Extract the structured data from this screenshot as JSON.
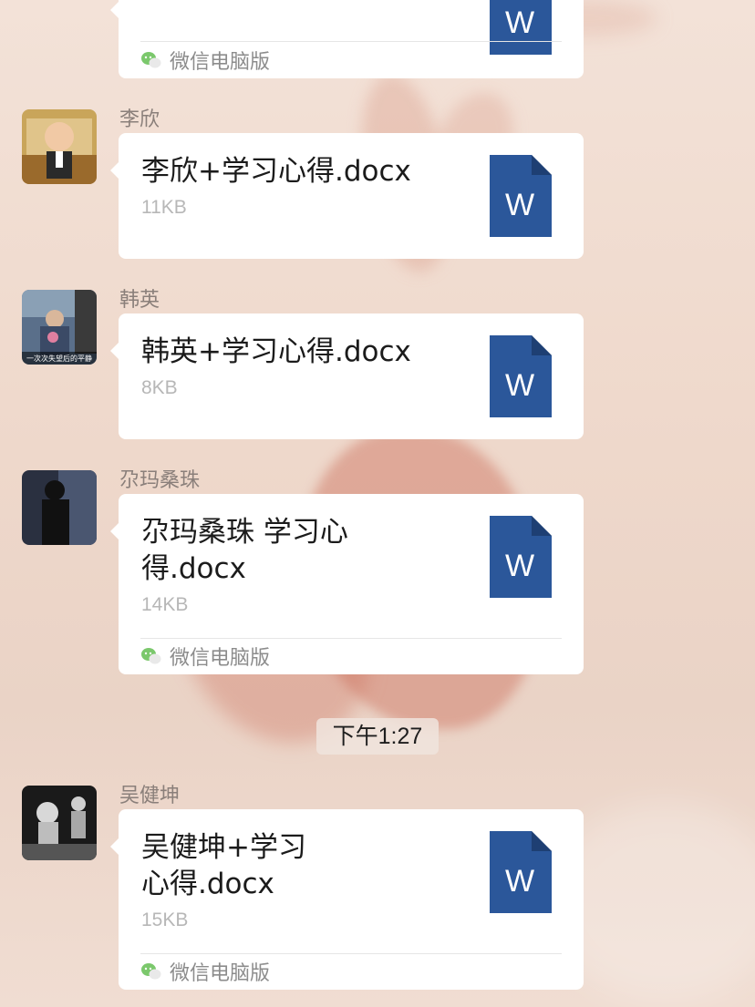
{
  "source_label": "微信电脑版",
  "messages": [
    {
      "sender": "李欣",
      "file_name": "李欣+学习心得.docx",
      "file_size": "11KB",
      "source": ""
    },
    {
      "sender": "韩英",
      "file_name": "韩英+学习心得.docx",
      "file_size": "8KB",
      "source": ""
    },
    {
      "sender": "尕玛桑珠",
      "file_name": "尕玛桑珠 学习心得.docx",
      "file_size": "14KB",
      "source": "微信电脑版"
    },
    {
      "sender": "吴健坤",
      "file_name": "吴健坤+学习心得.docx",
      "file_size": "15KB",
      "source": "微信电脑版"
    }
  ],
  "time_divider": "下午1:27",
  "avatar_captions": {
    "hanying": "一次次失望后的平静"
  },
  "colors": {
    "word_blue": "#2b579a",
    "bubble_bg": "#ffffff",
    "wechat_green": "#7bc86c"
  },
  "icons": {
    "word": "W"
  }
}
